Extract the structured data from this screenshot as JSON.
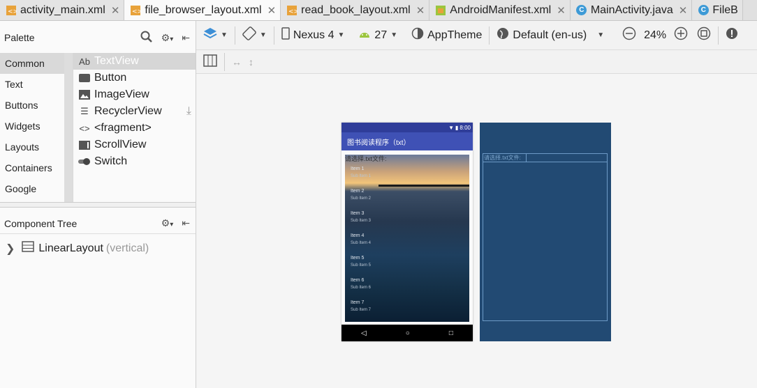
{
  "tabs": [
    {
      "label": "activity_main.xml",
      "icon": "xml-file-icon",
      "active": false
    },
    {
      "label": "file_browser_layout.xml",
      "icon": "xml-file-icon",
      "active": true
    },
    {
      "label": "read_book_layout.xml",
      "icon": "xml-file-icon",
      "active": false
    },
    {
      "label": "AndroidManifest.xml",
      "icon": "manifest-file-icon",
      "active": false
    },
    {
      "label": "MainActivity.java",
      "icon": "class-file-icon",
      "active": false
    },
    {
      "label": "FileB",
      "icon": "class-file-icon",
      "active": false
    }
  ],
  "palette": {
    "title": "Palette",
    "categories": [
      "Common",
      "Text",
      "Buttons",
      "Widgets",
      "Layouts",
      "Containers",
      "Google"
    ],
    "selected_category": "Common",
    "items": [
      {
        "label": "TextView",
        "icon_text": "Ab"
      },
      {
        "label": "Button",
        "icon_text": ""
      },
      {
        "label": "ImageView",
        "icon_text": ""
      },
      {
        "label": "RecyclerView",
        "icon_text": ""
      },
      {
        "label": "<fragment>",
        "icon_text": "<>"
      },
      {
        "label": "ScrollView",
        "icon_text": ""
      },
      {
        "label": "Switch",
        "icon_text": ""
      }
    ]
  },
  "component_tree": {
    "title": "Component Tree",
    "root_label": "LinearLayout",
    "root_sub": "(vertical)"
  },
  "toolbar": {
    "device": "Nexus 4",
    "api": "27",
    "theme": "AppTheme",
    "locale": "Default (en-us)",
    "zoom": "24%"
  },
  "phone": {
    "status_time": "8:00",
    "app_title": "图书阅读程序（txt）",
    "prompt": "请选择.txt文件:",
    "list_items": [
      {
        "title": "Item 1",
        "sub": "Sub Item 1"
      },
      {
        "title": "Item 2",
        "sub": "Sub Item 2"
      },
      {
        "title": "Item 3",
        "sub": "Sub Item 3"
      },
      {
        "title": "Item 4",
        "sub": "Sub Item 4"
      },
      {
        "title": "Item 5",
        "sub": "Sub Item 5"
      },
      {
        "title": "Item 6",
        "sub": "Sub Item 6"
      },
      {
        "title": "Item 7",
        "sub": "Sub Item 7"
      }
    ],
    "nav": [
      "◁",
      "○",
      "□"
    ]
  },
  "blueprint": {
    "prompt": "请选择.txt文件:"
  },
  "colors": {
    "accent": "#3f51b5",
    "status_bar": "#2f3d99",
    "blueprint": "#224a73"
  }
}
